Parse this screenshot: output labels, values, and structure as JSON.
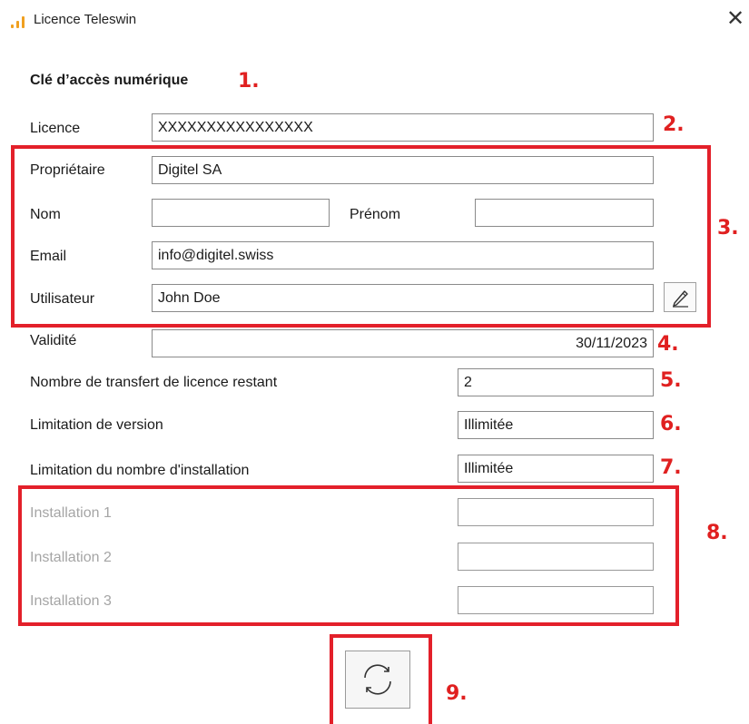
{
  "window": {
    "title": "Licence Teleswin",
    "close_glyph": "✕",
    "logo_icon": "signal-bars-icon",
    "accent_color": "#f0a020"
  },
  "section": {
    "title": "Clé d’accès numérique"
  },
  "annotation_color": "#e3202a",
  "markers": {
    "m1": "1.",
    "m2": "2.",
    "m3": "3.",
    "m4": "4.",
    "m5": "5.",
    "m6": "6.",
    "m7": "7.",
    "m8": "8.",
    "m9": "9."
  },
  "form": {
    "licence": {
      "label": "Licence",
      "value": "XXXXXXXXXXXXXXXX"
    },
    "proprietaire": {
      "label": "Propriétaire",
      "value": "Digitel SA"
    },
    "nom": {
      "label": "Nom",
      "value": ""
    },
    "prenom": {
      "label": "Prénom",
      "value": ""
    },
    "email": {
      "label": "Email",
      "value": "info@digitel.swiss"
    },
    "utilisateur": {
      "label": "Utilisateur",
      "value": "John Doe",
      "edit_icon": "pencil-icon"
    },
    "validite": {
      "label": "Validité",
      "value": "30/11/2023"
    },
    "transferts": {
      "label": "Nombre de transfert de licence restant",
      "value": "2"
    },
    "version": {
      "label": "Limitation de version",
      "value": "Illimitée"
    },
    "installation_limit": {
      "label": "Limitation du nombre d'installation",
      "value": "Illimitée"
    },
    "installations": [
      {
        "label": "Installation 1",
        "value": ""
      },
      {
        "label": "Installation 2",
        "value": ""
      },
      {
        "label": "Installation 3",
        "value": ""
      }
    ]
  },
  "refresh": {
    "icon": "refresh-icon"
  }
}
